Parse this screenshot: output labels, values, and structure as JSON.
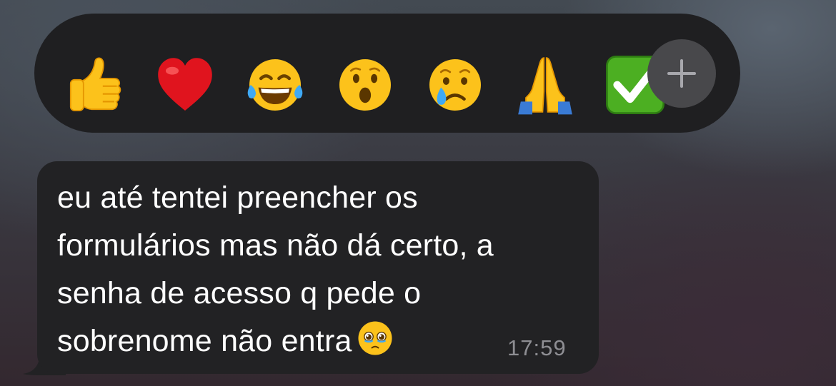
{
  "reaction_bar": {
    "reactions": [
      {
        "emoji": "👍",
        "icon": "thumbs-up-icon"
      },
      {
        "emoji": "❤️",
        "icon": "red-heart-icon"
      },
      {
        "emoji": "😂",
        "icon": "tears-of-joy-icon"
      },
      {
        "emoji": "😮",
        "icon": "open-mouth-face-icon"
      },
      {
        "emoji": "😢",
        "icon": "crying-face-icon"
      },
      {
        "emoji": "🙏",
        "icon": "folded-hands-icon"
      },
      {
        "emoji": "✅",
        "icon": "check-mark-button-icon"
      }
    ],
    "more_icon": "plus-icon",
    "colors": {
      "bar": "#1f1f21",
      "more_button": "#48484b"
    }
  },
  "message": {
    "lines": [
      "eu até tentei preencher os",
      "formulários mas não dá certo, a",
      "senha de acesso q pede o",
      "sobrenome não entra"
    ],
    "trailing_emoji": "🥹",
    "trailing_emoji_icon": "face-holding-back-tears-icon",
    "time": "17:59",
    "colors": {
      "bubble": "#222224",
      "text": "#ffffff",
      "time": "#8e8e93"
    }
  }
}
